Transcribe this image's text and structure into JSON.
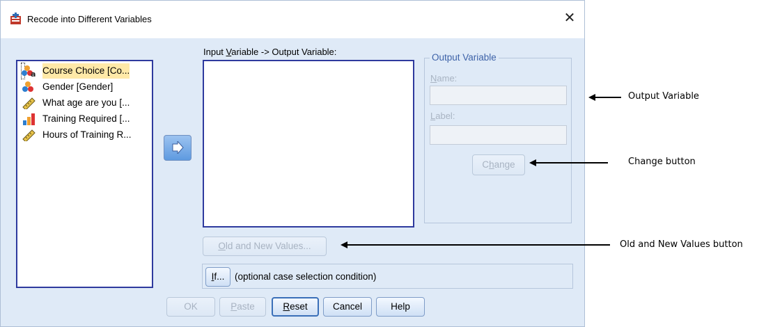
{
  "window": {
    "title": "Recode into Different Variables",
    "close_glyph": "✕"
  },
  "variables": [
    {
      "label": "Course Choice [Co...",
      "icon": "nominal-string-icon",
      "selected": true
    },
    {
      "label": "Gender [Gender]",
      "icon": "nominal-icon",
      "selected": false
    },
    {
      "label": "What age are you [...",
      "icon": "scale-ruler-icon",
      "selected": false
    },
    {
      "label": "Training Required [...",
      "icon": "ordinal-bar-icon",
      "selected": false
    },
    {
      "label": "Hours of Training R...",
      "icon": "scale-ruler-icon",
      "selected": false
    }
  ],
  "io": {
    "label_pre": "Input ",
    "label_u": "V",
    "label_post": "ariable -> Output Variable:"
  },
  "output": {
    "legend": "Output Variable",
    "name_u": "N",
    "name_rest": "ame:",
    "label_u": "L",
    "label_rest": "abel:",
    "change_pre": "C",
    "change_u": "h",
    "change_post": "ange"
  },
  "buttons": {
    "oldnew_u": "O",
    "oldnew_rest": "ld and New Values...",
    "if_u": "I",
    "if_rest": "f...",
    "if_hint": "(optional case selection condition)",
    "ok": "OK",
    "paste_u": "P",
    "paste_rest": "aste",
    "reset_u": "R",
    "reset_rest": "eset",
    "cancel": "Cancel",
    "help": "Help"
  },
  "annotations": {
    "output_variable": "Output Variable",
    "change_button": "Change button",
    "old_new_button": "Old and New Values button"
  },
  "colors": {
    "dialog_bg": "#dfeaf7",
    "list_border": "#2e3a9e",
    "accent_blue": "#3d62a8"
  }
}
